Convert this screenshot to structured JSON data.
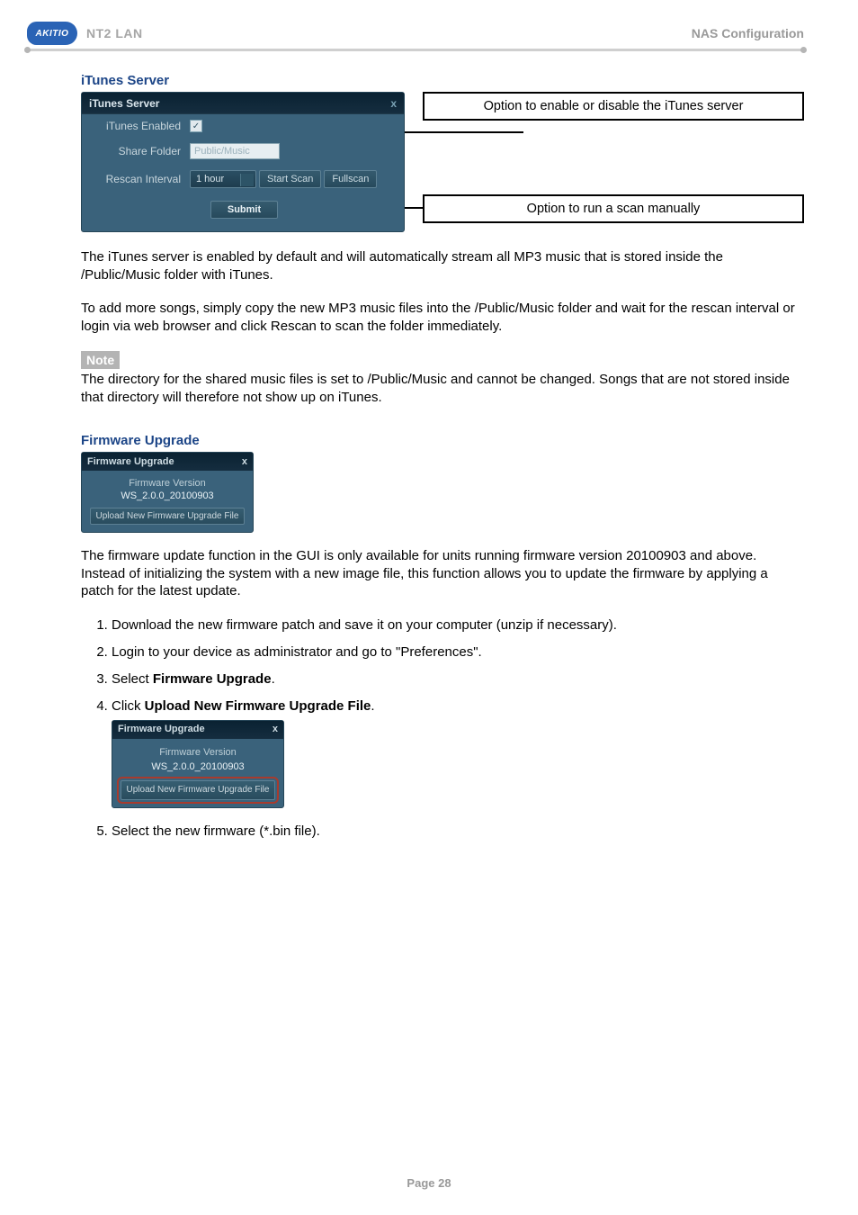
{
  "header": {
    "logo_text": "AKITIO",
    "product": "NT2 LAN",
    "right": "NAS Configuration"
  },
  "section_itunes": {
    "heading": "iTunes Server",
    "panel": {
      "title": "iTunes Server",
      "close": "x",
      "rows": {
        "enabled_label": "iTunes Enabled",
        "enabled_checked": "✓",
        "share_label": "Share Folder",
        "share_value": "Public/Music",
        "rescan_label": "Rescan Interval",
        "interval_value": "1 hour",
        "btn_start": "Start Scan",
        "btn_full": "Fullscan",
        "btn_submit": "Submit"
      }
    },
    "callouts": {
      "enable": "Option to enable or disable the iTunes server",
      "scan": "Option to run a scan manually"
    },
    "para1": "The iTunes server is enabled by default and will automatically stream all MP3 music that is stored inside the /Public/Music folder with iTunes.",
    "para2": "To add more songs, simply copy the new MP3 music files into the /Public/Music folder and wait for the rescan interval or login via web browser and click Rescan to scan the folder immediately.",
    "note_label": "Note",
    "note_text": "The directory for the shared music files is set to /Public/Music and cannot be changed. Songs that are not stored inside that directory will therefore not show up on iTunes."
  },
  "section_fw": {
    "heading": "Firmware Upgrade",
    "panel": {
      "title": "Firmware Upgrade",
      "close": "x",
      "fv_label": "Firmware Version",
      "fv_value": "WS_2.0.0_20100903",
      "upload_btn": "Upload New Firmware Upgrade File"
    },
    "para": "The firmware update function in the GUI is only available for units running firmware version 20100903 and above. Instead of initializing the system with a new image file, this function allows you to update the firmware by applying a patch for the latest update.",
    "steps": {
      "s1": "Download the new firmware patch and save it on your computer (unzip if necessary).",
      "s2": "Login to your device as administrator and go to \"Preferences\".",
      "s3_pre": "Select ",
      "s3_b": "Firmware Upgrade",
      "s3_post": ".",
      "s4_pre": "Click ",
      "s4_b": "Upload New Firmware Upgrade File",
      "s4_post": ".",
      "s5": "Select the new firmware (*.bin file)."
    }
  },
  "footer": "Page 28"
}
